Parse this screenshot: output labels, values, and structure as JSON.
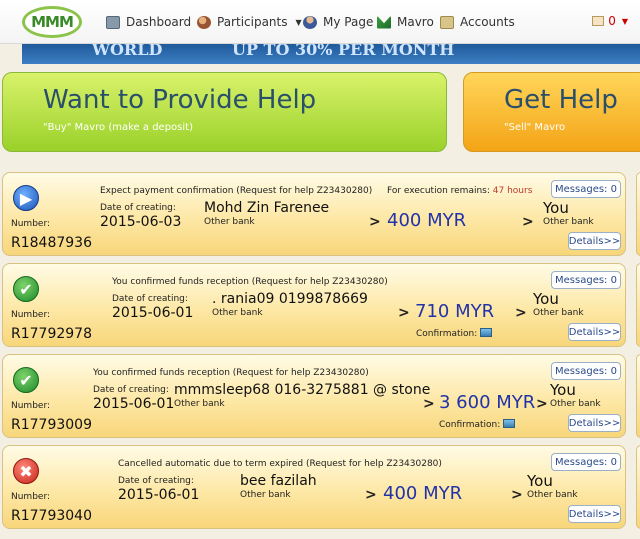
{
  "nav": {
    "logo": "MMM",
    "items": [
      {
        "label": "Dashboard"
      },
      {
        "label": "Participants"
      },
      {
        "label": "My Page"
      },
      {
        "label": "Mavro"
      },
      {
        "label": "Accounts"
      }
    ],
    "mail_count": "0"
  },
  "banner": {
    "left_text": "WORLD",
    "right_text": "UP TO 30% PER MONTH"
  },
  "provide": {
    "title": "Want to Provide Help",
    "subtitle": "\"Buy\" Mavro (make a deposit)"
  },
  "get": {
    "title": "Get Help",
    "subtitle": "\"Sell\" Mavro"
  },
  "common": {
    "number_label": "Number:",
    "date_label": "Date of creating:",
    "other_bank": "Other bank",
    "you": "You",
    "details": "Details>>",
    "confirmation": "Confirmation:",
    "arrow": ">"
  },
  "cards": [
    {
      "status": "Expect payment confirmation (Request for help Z23430280)",
      "remains": "For execution remains:",
      "hours": "47 hours",
      "messages": "Messages: 0",
      "date": "2015-06-03",
      "name": "Mohd Zin Farenee",
      "amount": "400 MYR",
      "number": "R18487936"
    },
    {
      "status": "You confirmed funds reception (Request for help Z23430280)",
      "messages": "Messages: 0",
      "date": "2015-06-01",
      "name": ". rania09 0199878669",
      "amount": "710 MYR",
      "number": "R17792978"
    },
    {
      "status": "You confirmed funds reception (Request for help Z23430280)",
      "messages": "Messages: 0",
      "date": "2015-06-01",
      "name": "mmmsleep68 016-3275881 @ stone",
      "amount": "3 600 MYR",
      "number": "R17793009"
    },
    {
      "status": "Cancelled automatic due to term expired (Request for help Z23430280)",
      "messages": "Messages: 0",
      "date": "2015-06-01",
      "name": "bee fazilah",
      "amount": "400 MYR",
      "number": "R17793040"
    }
  ]
}
